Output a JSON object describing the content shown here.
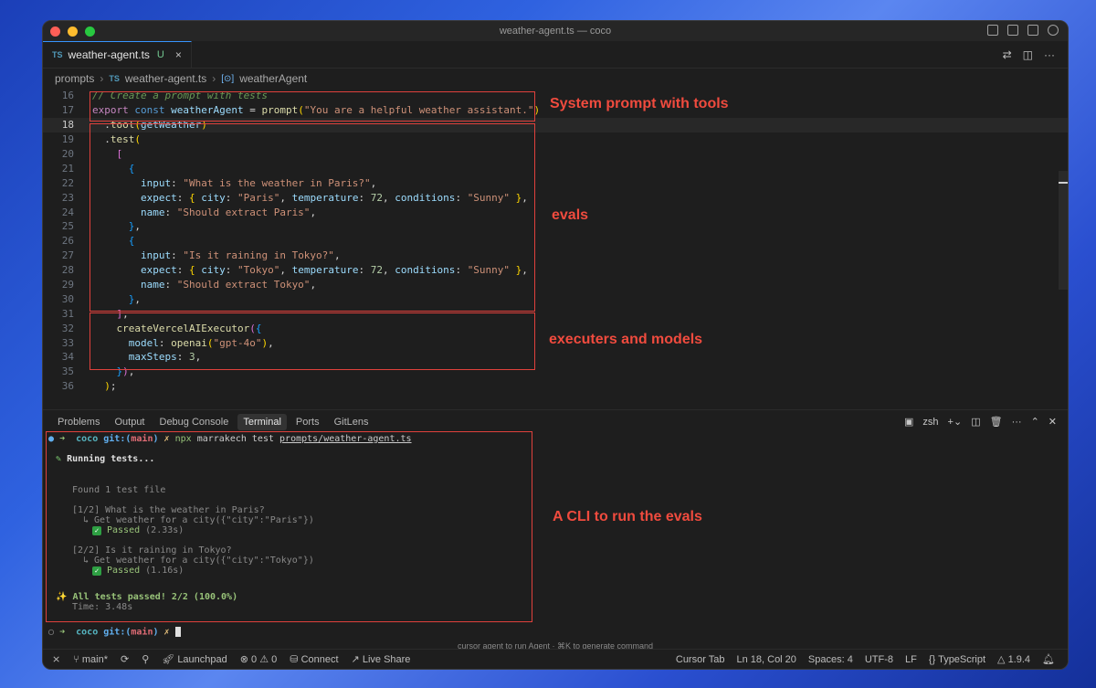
{
  "window": {
    "title": "weather-agent.ts — coco"
  },
  "tab": {
    "lang": "TS",
    "filename": "weather-agent.ts",
    "status": "U",
    "close": "×"
  },
  "breadcrumb": {
    "folder": "prompts",
    "lang": "TS",
    "file": "weather-agent.ts",
    "symbol_icon": "[⊙]",
    "symbol": "weatherAgent"
  },
  "editor": {
    "current_line": 18,
    "lines": [
      {
        "n": "16",
        "tokens": [
          [
            "com",
            "// Create a prompt with tests"
          ]
        ]
      },
      {
        "n": "17",
        "tokens": [
          [
            "kw",
            "export"
          ],
          [
            "",
            " "
          ],
          [
            "kw2",
            "const"
          ],
          [
            "",
            " "
          ],
          [
            "var",
            "weatherAgent"
          ],
          [
            "",
            " = "
          ],
          [
            "fn",
            "prompt"
          ],
          [
            "br1",
            "("
          ],
          [
            "str",
            "\"You are a helpful weather assistant.\""
          ],
          [
            "br1",
            ")"
          ]
        ]
      },
      {
        "n": "18",
        "tokens": [
          [
            "",
            "  ."
          ],
          [
            "fn",
            "tool"
          ],
          [
            "br1",
            "("
          ],
          [
            "var",
            "getWeather"
          ],
          [
            "br1",
            ")"
          ]
        ]
      },
      {
        "n": "19",
        "tokens": [
          [
            "",
            "  ."
          ],
          [
            "fn",
            "test"
          ],
          [
            "br1",
            "("
          ]
        ]
      },
      {
        "n": "20",
        "tokens": [
          [
            "",
            "    "
          ],
          [
            "br2",
            "["
          ]
        ]
      },
      {
        "n": "21",
        "tokens": [
          [
            "",
            "      "
          ],
          [
            "br3",
            "{"
          ]
        ]
      },
      {
        "n": "22",
        "tokens": [
          [
            "",
            "        "
          ],
          [
            "prop",
            "input"
          ],
          [
            "",
            ": "
          ],
          [
            "str",
            "\"What is the weather in Paris?\""
          ],
          [
            "",
            ","
          ]
        ]
      },
      {
        "n": "23",
        "tokens": [
          [
            "",
            "        "
          ],
          [
            "prop",
            "expect"
          ],
          [
            "",
            ": "
          ],
          [
            "br1",
            "{"
          ],
          [
            "",
            " "
          ],
          [
            "prop",
            "city"
          ],
          [
            "",
            ": "
          ],
          [
            "str",
            "\"Paris\""
          ],
          [
            "",
            ", "
          ],
          [
            "prop",
            "temperature"
          ],
          [
            "",
            ": "
          ],
          [
            "num",
            "72"
          ],
          [
            "",
            ", "
          ],
          [
            "prop",
            "conditions"
          ],
          [
            "",
            ": "
          ],
          [
            "str",
            "\"Sunny\""
          ],
          [
            "",
            " "
          ],
          [
            "br1",
            "}"
          ],
          [
            "",
            ","
          ]
        ]
      },
      {
        "n": "24",
        "tokens": [
          [
            "",
            "        "
          ],
          [
            "prop",
            "name"
          ],
          [
            "",
            ": "
          ],
          [
            "str",
            "\"Should extract Paris\""
          ],
          [
            "",
            ","
          ]
        ]
      },
      {
        "n": "25",
        "tokens": [
          [
            "",
            "      "
          ],
          [
            "br3",
            "}"
          ],
          [
            "",
            ","
          ]
        ]
      },
      {
        "n": "26",
        "tokens": [
          [
            "",
            "      "
          ],
          [
            "br3",
            "{"
          ]
        ]
      },
      {
        "n": "27",
        "tokens": [
          [
            "",
            "        "
          ],
          [
            "prop",
            "input"
          ],
          [
            "",
            ": "
          ],
          [
            "str",
            "\"Is it raining in Tokyo?\""
          ],
          [
            "",
            ","
          ]
        ]
      },
      {
        "n": "28",
        "tokens": [
          [
            "",
            "        "
          ],
          [
            "prop",
            "expect"
          ],
          [
            "",
            ": "
          ],
          [
            "br1",
            "{"
          ],
          [
            "",
            " "
          ],
          [
            "prop",
            "city"
          ],
          [
            "",
            ": "
          ],
          [
            "str",
            "\"Tokyo\""
          ],
          [
            "",
            ", "
          ],
          [
            "prop",
            "temperature"
          ],
          [
            "",
            ": "
          ],
          [
            "num",
            "72"
          ],
          [
            "",
            ", "
          ],
          [
            "prop",
            "conditions"
          ],
          [
            "",
            ": "
          ],
          [
            "str",
            "\"Sunny\""
          ],
          [
            "",
            " "
          ],
          [
            "br1",
            "}"
          ],
          [
            "",
            ","
          ]
        ]
      },
      {
        "n": "29",
        "tokens": [
          [
            "",
            "        "
          ],
          [
            "prop",
            "name"
          ],
          [
            "",
            ": "
          ],
          [
            "str",
            "\"Should extract Tokyo\""
          ],
          [
            "",
            ","
          ]
        ]
      },
      {
        "n": "30",
        "tokens": [
          [
            "",
            "      "
          ],
          [
            "br3",
            "}"
          ],
          [
            "",
            ","
          ]
        ]
      },
      {
        "n": "31",
        "tokens": [
          [
            "",
            "    "
          ],
          [
            "br2",
            "]"
          ],
          [
            "",
            ","
          ]
        ]
      },
      {
        "n": "32",
        "tokens": [
          [
            "",
            "    "
          ],
          [
            "fn",
            "createVercelAIExecutor"
          ],
          [
            "br2",
            "("
          ],
          [
            "br3",
            "{"
          ]
        ]
      },
      {
        "n": "33",
        "tokens": [
          [
            "",
            "      "
          ],
          [
            "prop",
            "model"
          ],
          [
            "",
            ": "
          ],
          [
            "fn",
            "openai"
          ],
          [
            "br1",
            "("
          ],
          [
            "str",
            "\"gpt-4o\""
          ],
          [
            "br1",
            ")"
          ],
          [
            "",
            ","
          ]
        ]
      },
      {
        "n": "34",
        "tokens": [
          [
            "",
            "      "
          ],
          [
            "prop",
            "maxSteps"
          ],
          [
            "",
            ": "
          ],
          [
            "num",
            "3"
          ],
          [
            "",
            ","
          ]
        ]
      },
      {
        "n": "35",
        "tokens": [
          [
            "",
            "    "
          ],
          [
            "br3",
            "}"
          ],
          [
            "br2",
            ")"
          ],
          [
            "",
            ","
          ]
        ]
      },
      {
        "n": "36",
        "tokens": [
          [
            "",
            "  "
          ],
          [
            "br1",
            ")"
          ],
          [
            "",
            ";"
          ]
        ]
      }
    ]
  },
  "annotations": {
    "system_prompt": "System prompt with tools",
    "evals": "evals",
    "executors": "executers and models",
    "cli": "A CLI to run the evals"
  },
  "panel": {
    "tabs": [
      "Problems",
      "Output",
      "Debug Console",
      "Terminal",
      "Ports",
      "GitLens"
    ],
    "active_tab": "Terminal",
    "shell": "zsh"
  },
  "terminal": {
    "prompt_dir": "coco",
    "git_label": "git:",
    "branch": "main",
    "command": "npx",
    "command_args": "marrakech test",
    "command_file": "prompts/weather-agent.ts",
    "running": "Running tests...",
    "found": "Found 1 test file",
    "test1_title": "[1/2] What is the weather in Paris?",
    "test1_tool": "↳ Get weather for a city({\"city\":\"Paris\"})",
    "test1_status": "Passed",
    "test1_time": "(2.33s)",
    "test2_title": "[2/2] Is it raining in Tokyo?",
    "test2_tool": "↳ Get weather for a city({\"city\":\"Tokyo\"})",
    "test2_status": "Passed",
    "test2_time": "(1.16s)",
    "summary": "All tests passed! 2/2 (100.0%)",
    "time": "Time: 3.48s",
    "hint": "cursor agent to run Agent · ⌘K to generate command"
  },
  "status": {
    "branch": "main*",
    "launchpad": "Launchpad",
    "errors": "0",
    "warnings": "0",
    "connect": "Connect",
    "liveshare": "Live Share",
    "cursor_tab": "Cursor Tab",
    "position": "Ln 18, Col 20",
    "spaces": "Spaces: 4",
    "encoding": "UTF-8",
    "eol": "LF",
    "language": "TypeScript",
    "version": "1.9.4"
  },
  "colors": {
    "annotation": "#e0413c",
    "accent": "#3794ff"
  }
}
